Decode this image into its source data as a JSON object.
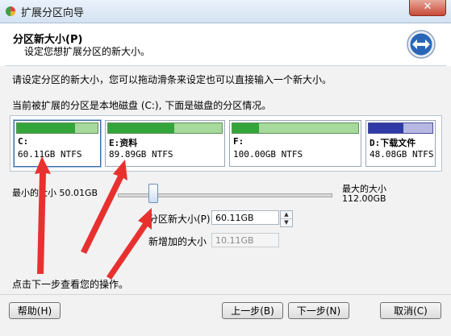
{
  "window": {
    "title": "扩展分区向导",
    "close_label": "✕"
  },
  "header": {
    "title": "分区新大小(P)",
    "subtitle": "设定您想扩展分区的新大小。"
  },
  "body": {
    "description": "请设定分区的新大小，您可以拖动滑条来设定也可以直接输入一个新大小。",
    "disk_info": "当前被扩展的分区是本地磁盘 (C:), 下面是磁盘的分区情况。",
    "partitions": [
      {
        "name": "C:",
        "size": "60.11GB NTFS",
        "fill": 0.72,
        "color": "#34a53a",
        "selected": true
      },
      {
        "name": "E:资料",
        "size": "89.89GB NTFS",
        "fill": 0.58,
        "color": "#34a53a",
        "selected": false
      },
      {
        "name": "F:",
        "size": "100.00GB NTFS",
        "fill": 0.21,
        "color": "#34a53a",
        "selected": false
      },
      {
        "name": "D:下载文件",
        "size": "48.08GB NTFS",
        "fill": 0.55,
        "color": "#2f3aa6",
        "selected": false
      }
    ],
    "min_label": "最小的大小 50.01GB",
    "max_label": "最大的大小",
    "max_value": "112.00GB",
    "slider_level": 0.162,
    "new_size_label": "分区新大小(P)",
    "new_size_value": "60.11GB",
    "added_size_label": "新增加的大小",
    "added_size_value": "10.11GB",
    "footer_note": "点击下一步查看您的操作。"
  },
  "buttons": {
    "help": "帮助(H)",
    "back": "上一步(B)",
    "next": "下一步(N)",
    "cancel": "取消(C)"
  },
  "colors": {
    "annotation_arrow": "#e8312f",
    "unused_bar": "#a6d99b",
    "unused_bar_d": "#b7b8e2"
  }
}
